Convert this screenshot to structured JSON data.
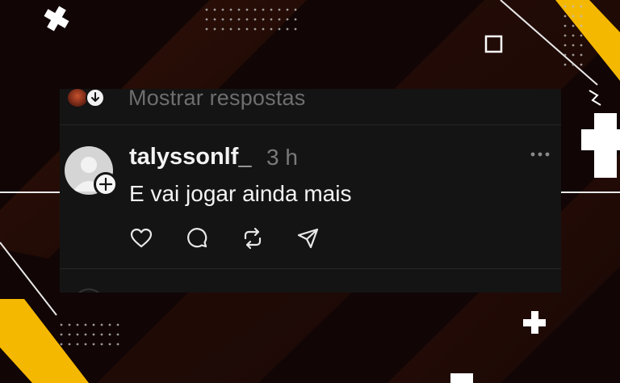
{
  "thread": {
    "show_replies": "Mostrar respostas"
  },
  "post": {
    "username": "talyssonlf_",
    "time": "3 h",
    "text": "E vai jogar ainda mais"
  },
  "icons": {
    "like": "heart-icon",
    "reply": "comment-icon",
    "repost": "repost-icon",
    "share": "send-icon",
    "more": "more-dots-icon"
  },
  "colors": {
    "accent": "#f5b800",
    "card": "#141414",
    "text": "#f3f3f3",
    "muted": "#7a7a7a"
  }
}
